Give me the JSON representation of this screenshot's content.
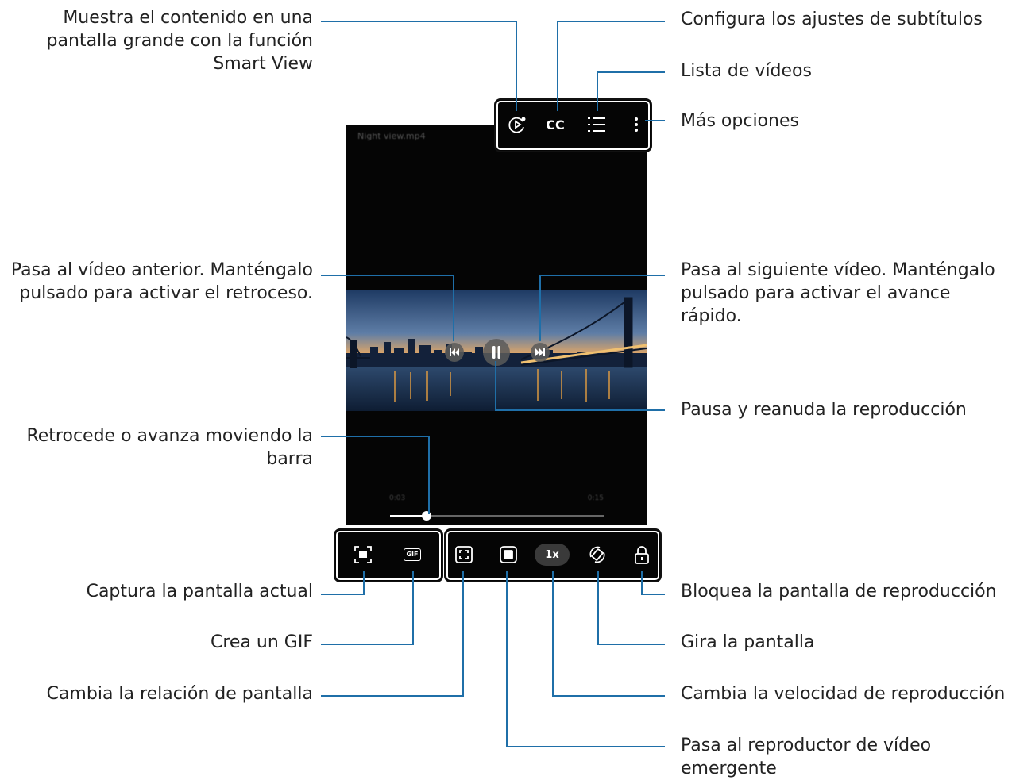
{
  "player": {
    "filename": "Night view.mp4",
    "time_current": "0:03",
    "time_total": "0:15",
    "progress": 0.17,
    "speed_label": "1x",
    "cc_label": "CC",
    "gif_label": "GIF"
  },
  "labels": {
    "smart_view": "Muestra el contenido en una\npantalla grande con la función\nSmart View",
    "subtitles": "Configura los ajustes de subtítulos",
    "video_list": "Lista de vídeos",
    "more_options": "Más opciones",
    "previous": "Pasa al vídeo anterior. Manténgalo\npulsado para activar el retroceso.",
    "next": "Pasa al siguiente vídeo. Manténgalo\npulsado para activar el avance\nrápido.",
    "pause": "Pausa y reanuda la reproducción",
    "seek": "Retrocede o avanza moviendo la\nbarra",
    "capture": "Captura la pantalla actual",
    "gif": "Crea un GIF",
    "ratio": "Cambia la relación de pantalla",
    "lock": "Bloquea la pantalla de reproducción",
    "rotate": "Gira la pantalla",
    "speed": "Cambia la velocidad de reproducción",
    "popup": "Pasa al reproductor de vídeo\nemergente"
  },
  "colors": {
    "callout_line": "#1f6fa8",
    "screen_bg": "#050505"
  }
}
